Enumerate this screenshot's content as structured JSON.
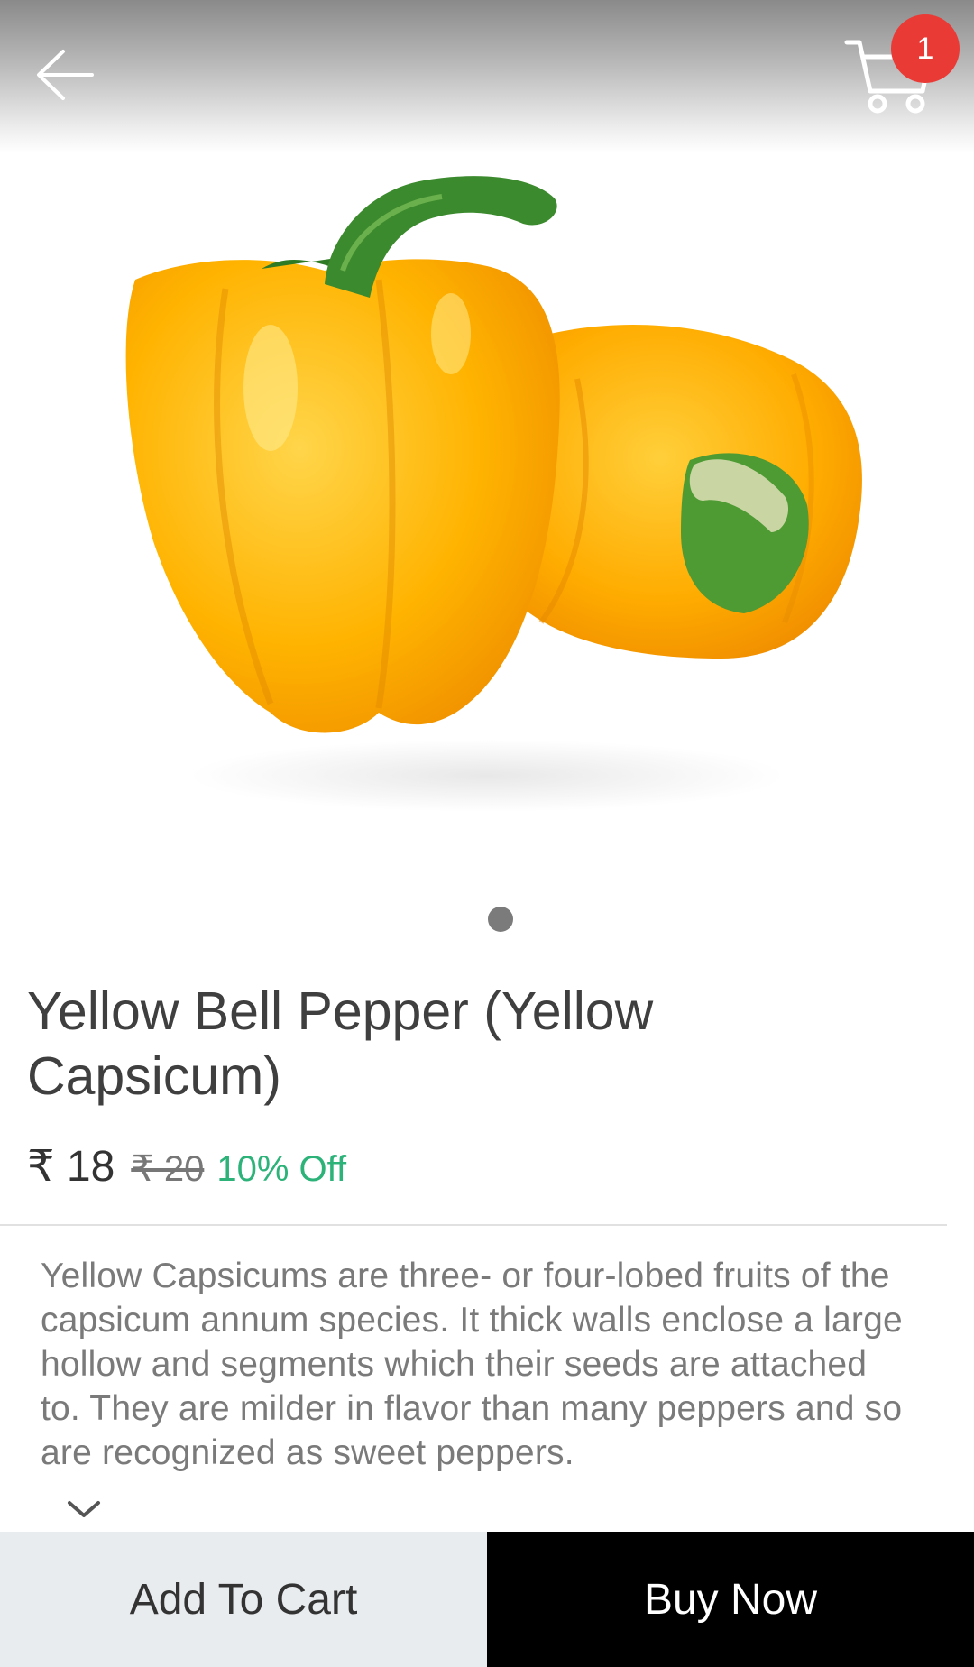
{
  "header": {
    "back_icon": "arrow-left-icon",
    "cart_icon": "shopping-cart-icon",
    "cart_count": "1"
  },
  "product": {
    "image_icon": "yellow-bell-pepper-image",
    "image_count": 1,
    "title": "Yellow Bell Pepper (Yellow Capsicum)",
    "price": "₹ 18",
    "mrp": "₹ 20",
    "discount": "10% Off",
    "description": "Yellow Capsicums are three- or four-lobed fruits of the capsicum annum species. It thick walls enclose a large hollow and segments which their seeds are attached to. They are milder in flavor than many peppers and so are recognized as sweet peppers.",
    "expand_icon": "chevron-down-icon"
  },
  "actions": {
    "add_to_cart": "Add To Cart",
    "buy_now": "Buy Now"
  },
  "colors": {
    "badge": "#ea3a36",
    "discount": "#2db37a",
    "pepper": "#ffb300",
    "stem": "#3c8a2e"
  }
}
